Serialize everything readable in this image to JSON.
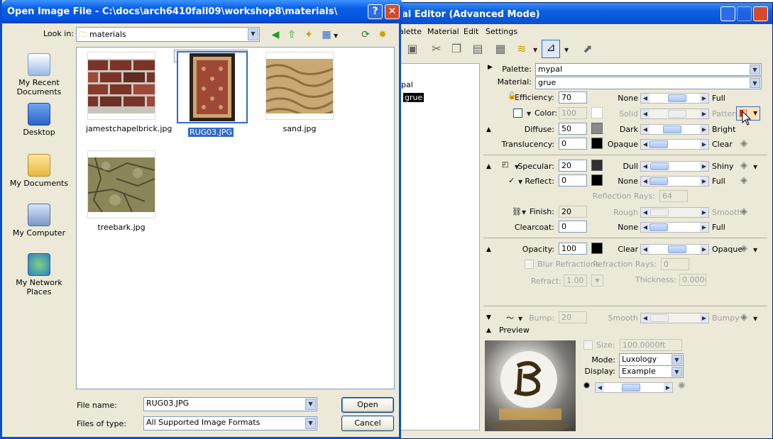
{
  "material_editor": {
    "title": "al Editor (Advanced Mode)",
    "menu": [
      "alette",
      "Material",
      "Edit",
      "Settings"
    ],
    "tree": {
      "palette_item": "pal",
      "material_item": "grue"
    },
    "palette": {
      "label": "Palette:",
      "value": "mypal"
    },
    "material": {
      "label": "Material:",
      "value": "grue"
    },
    "efficiency": {
      "label": "Efficiency:",
      "value": "70",
      "left": "None",
      "right": "Full",
      "level": 0.55
    },
    "color": {
      "label": "Color:",
      "value": "100",
      "left": "Solid",
      "right": "Pattern",
      "level": 0.55
    },
    "diffuse": {
      "label": "Diffuse:",
      "value": "50",
      "left": "Dark",
      "right": "Bright",
      "level": 0.45,
      "swatch": "#8a8a8a"
    },
    "translucency": {
      "label": "Translucency:",
      "value": "0",
      "left": "Opaque",
      "right": "Clear",
      "level": 0.1,
      "swatch": "#000000"
    },
    "specular": {
      "label": "Specular:",
      "value": "20",
      "left": "Dull",
      "right": "Shiny",
      "level": 0.2,
      "swatch": "#303030"
    },
    "reflect": {
      "label": "Reflect:",
      "value": "0",
      "left": "None",
      "right": "Full",
      "level": 0.1,
      "swatch": "#000000"
    },
    "reflection_rays": {
      "label": "Reflection Rays:",
      "value": "64"
    },
    "finish": {
      "label": "Finish:",
      "value": "20",
      "left": "Rough",
      "right": "Smooth",
      "level": 0.2
    },
    "clearcoat": {
      "label": "Clearcoat:",
      "value": "0",
      "left": "None",
      "right": "Full",
      "level": 0.1
    },
    "opacity": {
      "label": "Opacity:",
      "value": "100",
      "left": "Clear",
      "right": "Opaque",
      "level": 0.55,
      "swatch": "#000000"
    },
    "blur_refractions": "Blur Refractions",
    "refraction_rays": {
      "label": "Refraction Rays:",
      "value": "0"
    },
    "refract": {
      "label": "Refract:",
      "value": "1.00"
    },
    "thickness": {
      "label": "Thickness:",
      "value": "0.000("
    },
    "bump": {
      "label": "Bump:",
      "value": "20",
      "left": "Smooth",
      "right": "Bumpy",
      "level": 0.2
    },
    "preview_label": "Preview",
    "size": {
      "label": "Size:",
      "value": "100.0000ft"
    },
    "mode": {
      "label": "Mode:",
      "value": "Luxology"
    },
    "display": {
      "label": "Display:",
      "value": "Example"
    },
    "light_level": 0.45
  },
  "dialog": {
    "title": "Open Image File - C:\\docs\\arch6410fall09\\workshop8\\materials\\",
    "look_in_label": "Look in:",
    "look_in_value": "materials",
    "places": [
      "My Recent Documents",
      "Desktop",
      "My Documents",
      "My Computer",
      "My Network Places"
    ],
    "files": [
      {
        "name": "jamestchapelbrick.jpg",
        "selected": false,
        "colors": [
          "#6f3128",
          "#9a4a3a",
          "#c8c4bc"
        ]
      },
      {
        "name": "RUG03.JPG",
        "selected": true,
        "colors": [
          "#2c2318",
          "#a24a3a",
          "#d9b07e"
        ]
      },
      {
        "name": "sand.jpg",
        "selected": false,
        "colors": [
          "#c8a872",
          "#9c7a48",
          "#e1c594"
        ]
      },
      {
        "name": "treebark.jpg",
        "selected": false,
        "colors": [
          "#8a8658",
          "#5d5a3a",
          "#b4b287"
        ]
      }
    ],
    "file_name_label": "File name:",
    "file_name_value": "RUG03.JPG",
    "file_type_label": "Files of type:",
    "file_type_value": "All Supported Image Formats",
    "open_button": "Open",
    "cancel_button": "Cancel"
  }
}
